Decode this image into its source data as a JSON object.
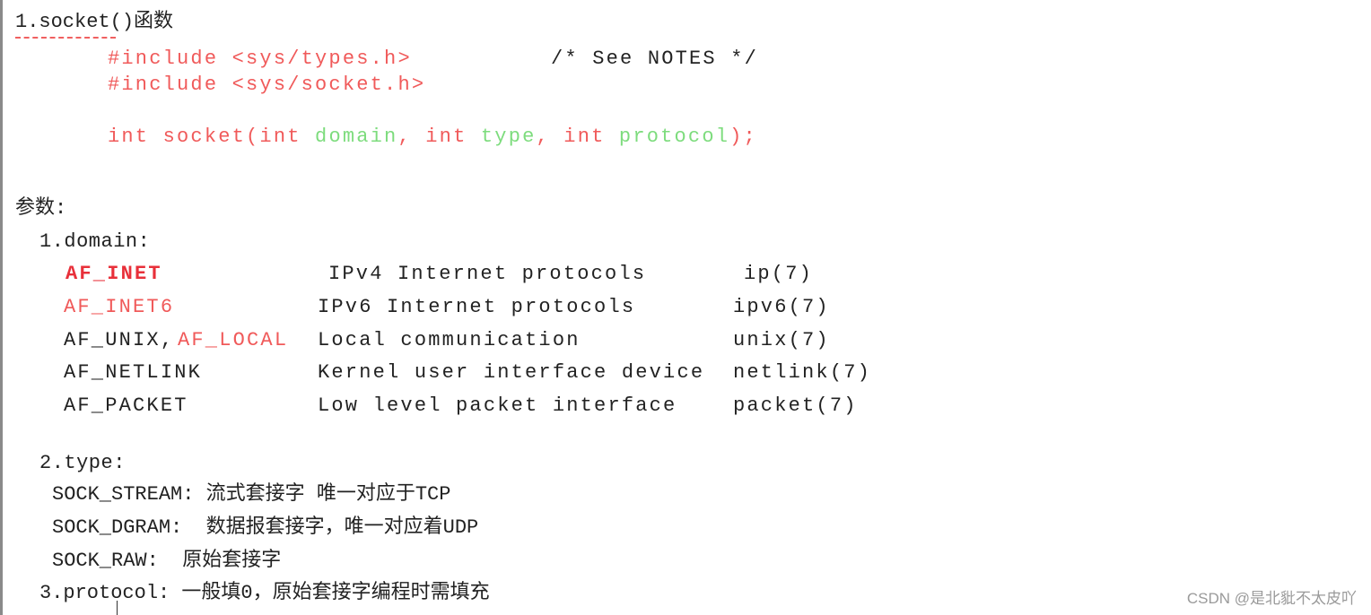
{
  "title": "1.socket()函数",
  "code": {
    "include1": "#include <sys/types.h>",
    "include1_comment": "/* See NOTES */",
    "include2": "#include <sys/socket.h>",
    "sig": {
      "a": "int socket(int ",
      "b": "domain",
      "c": ", int ",
      "d": "type",
      "e": ", int ",
      "f": "protocol",
      "g": ");"
    }
  },
  "params_label": "参数:",
  "domain": {
    "label": "1.domain:",
    "rows": [
      {
        "name": "AF_INET",
        "desc": "IPv4 Internet protocols",
        "ref": "ip(7)"
      },
      {
        "name": "AF_INET6",
        "desc": "IPv6 Internet protocols",
        "ref": "ipv6(7)"
      },
      {
        "name": "AF_UNIX,",
        "name2": "AF_LOCAL",
        "desc": "Local communication",
        "ref": "unix(7)"
      },
      {
        "name": "AF_NETLINK",
        "desc": "Kernel user interface device",
        "ref": "netlink(7)"
      },
      {
        "name": "AF_PACKET",
        "desc": "Low level packet interface",
        "ref": "packet(7)"
      }
    ]
  },
  "type": {
    "label": "2.type:",
    "rows": [
      "SOCK_STREAM: 流式套接字 唯一对应于TCP",
      "SOCK_DGRAM:  数据报套接字，唯一对应着UDP",
      "SOCK_RAW:  原始套接字"
    ]
  },
  "protocol": "3.protocol: 一般填0，原始套接字编程时需填充",
  "watermark": "CSDN @是北豼不太皮吖",
  "colors": {
    "red": "#f05a5a",
    "green": "#7ddc7d",
    "bold_red": "#e8303a"
  }
}
